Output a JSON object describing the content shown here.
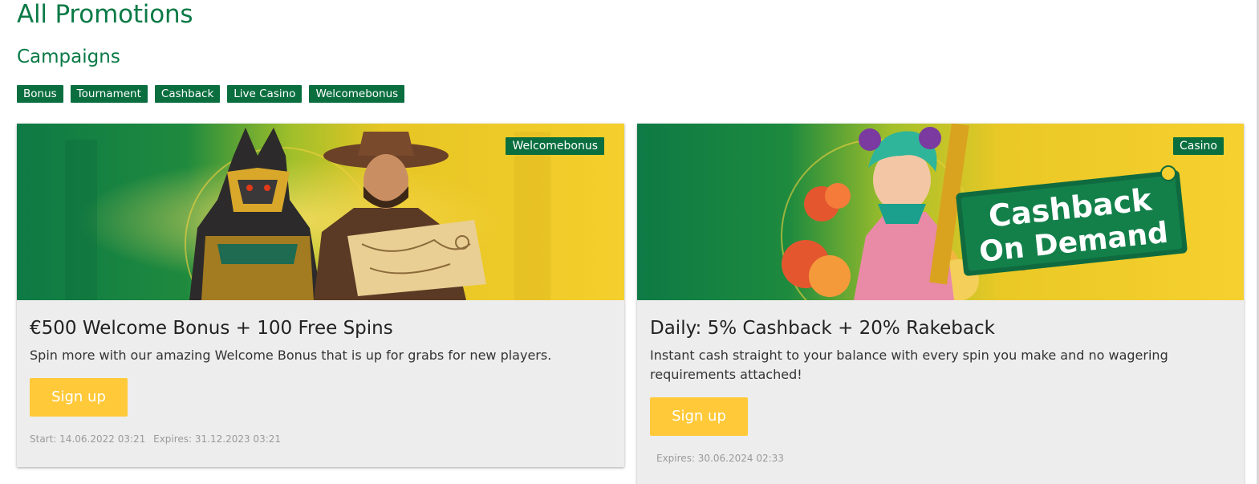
{
  "page": {
    "title": "All Promotions"
  },
  "campaigns": {
    "heading": "Campaigns",
    "filters": [
      "Bonus",
      "Tournament",
      "Cashback",
      "Live Casino",
      "Welcomebonus"
    ]
  },
  "promotions": [
    {
      "badge": "Welcomebonus",
      "title": "€500 Welcome Bonus + 100 Free Spins",
      "description": "Spin more with our amazing Welcome Bonus that is up for grabs for new players.",
      "button": "Sign up",
      "start": "Start: 14.06.2022 03:21",
      "expires": "Expires: 31.12.2023 03:21"
    },
    {
      "badge": "Casino",
      "title": "Daily: 5% Cashback + 20% Rakeback",
      "description": "Instant cash straight to your balance with every spin you make and no wagering requirements attached!",
      "button": "Sign up",
      "expires": "Expires: 30.06.2024 02:33",
      "banner_text_line1": "Cashback",
      "banner_text_line2": "On Demand"
    }
  ],
  "colors": {
    "brand_green": "#0a6e3f",
    "title_green": "#0a7a46",
    "button_yellow": "#ffc93a",
    "card_bg": "#ededed"
  }
}
